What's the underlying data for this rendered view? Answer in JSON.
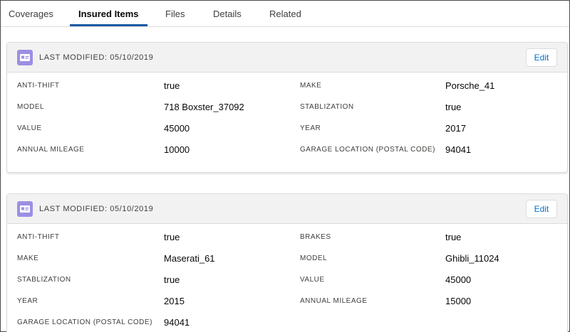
{
  "tabs": [
    "Coverages",
    "Insured Items",
    "Files",
    "Details",
    "Related"
  ],
  "active_tab": "Insured Items",
  "colors": {
    "accent": "#1b5aa3",
    "icon_bg": "#9b8fe4",
    "link": "#0070d2",
    "header_bg": "#f3f2f2"
  },
  "cards": [
    {
      "icon": "contact-card-icon",
      "title": "LAST MODIFIED: 05/10/2019",
      "edit_label": "Edit",
      "rows": [
        [
          {
            "label": "ANTI-THIFT",
            "value": "true"
          },
          {
            "label": "MAKE",
            "value": "Porsche_41"
          }
        ],
        [
          {
            "label": "MODEL",
            "value": "718 Boxster_37092"
          },
          {
            "label": "STABLIZATION",
            "value": "true"
          }
        ],
        [
          {
            "label": "VALUE",
            "value": "45000"
          },
          {
            "label": "YEAR",
            "value": "2017"
          }
        ],
        [
          {
            "label": "ANNUAL MILEAGE",
            "value": "10000"
          },
          {
            "label": "GARAGE LOCATION (POSTAL CODE)",
            "value": "94041"
          }
        ]
      ]
    },
    {
      "icon": "contact-card-icon",
      "title": "LAST MODIFIED: 05/10/2019",
      "edit_label": "Edit",
      "rows": [
        [
          {
            "label": "ANTI-THIFT",
            "value": "true"
          },
          {
            "label": "BRAKES",
            "value": "true"
          }
        ],
        [
          {
            "label": "MAKE",
            "value": "Maserati_61"
          },
          {
            "label": "MODEL",
            "value": "Ghibli_11024"
          }
        ],
        [
          {
            "label": "STABLIZATION",
            "value": "true"
          },
          {
            "label": "VALUE",
            "value": "45000"
          }
        ],
        [
          {
            "label": "YEAR",
            "value": "2015"
          },
          {
            "label": "ANNUAL MILEAGE",
            "value": "15000"
          }
        ],
        [
          {
            "label": "GARAGE LOCATION (POSTAL CODE)",
            "value": "94041"
          }
        ]
      ]
    }
  ]
}
